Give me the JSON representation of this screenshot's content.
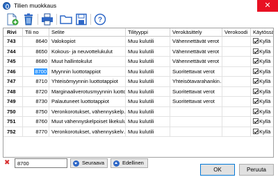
{
  "window": {
    "title": "Tilien muokkaus",
    "close_label": "✕"
  },
  "toolbar": {
    "icons": [
      "add-record-icon",
      "delete-record-icon",
      "print-icon",
      "open-folder-icon",
      "save-icon",
      "help-icon"
    ],
    "help_label": "?"
  },
  "grid": {
    "columns": [
      "Rivi",
      "Tili no",
      "Selite",
      "Tilityyppi",
      "Verokäsittely",
      "Verokoodi",
      "Käytössä"
    ],
    "rows": [
      {
        "rivi": "743",
        "tili": "8640",
        "selite": "Valokopiot",
        "tyyppi": "Muu kulutili",
        "vero": "Vähennettävät verot",
        "koodi": "",
        "kaytossa": "Kyllä"
      },
      {
        "rivi": "744",
        "tili": "8650",
        "selite": "Kokous- ja neuvottelukulut",
        "tyyppi": "Muu kulutili",
        "vero": "Vähennettävät verot",
        "koodi": "",
        "kaytossa": "Kyllä"
      },
      {
        "rivi": "745",
        "tili": "8680",
        "selite": "Muut hallintokulut",
        "tyyppi": "Muu kulutili",
        "vero": "Vähennettävät verot",
        "koodi": "",
        "kaytossa": "Kyllä"
      },
      {
        "rivi": "746",
        "tili": "8700",
        "selite": "Myynnin luottotappiot",
        "tyyppi": "Muu kulutili",
        "vero": "Suoritettavat verot",
        "koodi": "",
        "kaytossa": "Kyllä"
      },
      {
        "rivi": "747",
        "tili": "8710",
        "selite": "Yhteisömyynnin luottotappiot",
        "tyyppi": "Muu kulutili",
        "vero": "Yhteisötavarahankin…",
        "koodi": "",
        "kaytossa": "Kyllä"
      },
      {
        "rivi": "748",
        "tili": "8720",
        "selite": "Marginaaliverotusmyynnin luotto…",
        "tyyppi": "Muu kulutili",
        "vero": "Suoritettavat verot",
        "koodi": "",
        "kaytossa": "Kyllä"
      },
      {
        "rivi": "749",
        "tili": "8730",
        "selite": "Palautuneet luottotappiot",
        "tyyppi": "Muu kulutili",
        "vero": "Suoritettavat verot",
        "koodi": "",
        "kaytossa": "Kyllä"
      },
      {
        "rivi": "750",
        "tili": "8750",
        "selite": "Veronkorotukset, vähennyskelp…",
        "tyyppi": "Muu kulutili",
        "vero": "",
        "koodi": "",
        "kaytossa": "Kyllä"
      },
      {
        "rivi": "751",
        "tili": "8760",
        "selite": "Muut vähennyskelpoiset likekulut",
        "tyyppi": "Muu kulutili",
        "vero": "",
        "koodi": "",
        "kaytossa": "Kyllä"
      },
      {
        "rivi": "752",
        "tili": "8770",
        "selite": "Veronkorotukset, vähennyskelv…",
        "tyyppi": "Muu kulutili",
        "vero": "",
        "koodi": "",
        "kaytossa": "Kyllä"
      }
    ],
    "highlight": {
      "row_index": 3,
      "text": "8700"
    }
  },
  "search": {
    "value": "8700",
    "next_label": "Seuraava",
    "prev_label": "Edellinen"
  },
  "footer": {
    "ok_label": "OK",
    "cancel_label": "Peruuta"
  },
  "colors": {
    "close_red": "#e81123",
    "selection_blue": "#3399ff",
    "nav_blue": "#2f68c7"
  }
}
